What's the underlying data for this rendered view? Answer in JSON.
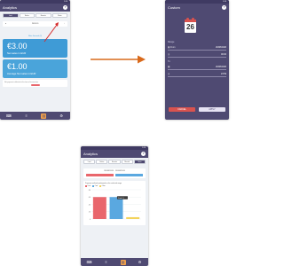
{
  "analytics": {
    "status_time": "9:26",
    "title": "Analytics",
    "tabs": [
      "Last",
      "Sales",
      "Events",
      "Stats"
    ],
    "period_label": "PERIOD",
    "period_link": "Filter /Interval (2)",
    "net_sales_value": "€3.00",
    "net_sales_label": "Net sales in EUR",
    "avg_value": "€1.00",
    "avg_label": "Average Net sales in EUR",
    "note_text": "Net payment collected at the time of transaction"
  },
  "custom": {
    "title": "Custom",
    "calendar_day": "26",
    "section_label": "Range",
    "rows": [
      {
        "label": "From",
        "value": "26/08/2020"
      },
      {
        "label": "",
        "value": "00:00"
      },
      {
        "label": "To",
        "value": "26/08/2020"
      },
      {
        "label": "",
        "value": "23:59"
      }
    ],
    "cancel_label": "CANCEL",
    "apply_label": "APPLY"
  },
  "analytics_chart": {
    "title": "Analytics",
    "tabs": [
      "Last",
      "Sales",
      "Events",
      "Month",
      "Sum"
    ],
    "range_title": "26/08/2020 · 26/08/2020",
    "chart_title": "Payment methods performed on the selected range",
    "legend": [
      "Cash",
      "Card",
      "Other"
    ],
    "tooltip": "Card: 3",
    "colors": {
      "cash": "#e9666c",
      "card": "#5aa8e0",
      "other": "#f3d35b"
    }
  },
  "chart_data": {
    "type": "bar",
    "categories": [
      "Cash",
      "Card",
      "Other"
    ],
    "values": [
      60,
      60,
      5
    ],
    "ylim": [
      0,
      80
    ],
    "ytick_labels": [
      "0",
      "20",
      "40",
      "60",
      "80"
    ],
    "legend_placement": "top"
  }
}
